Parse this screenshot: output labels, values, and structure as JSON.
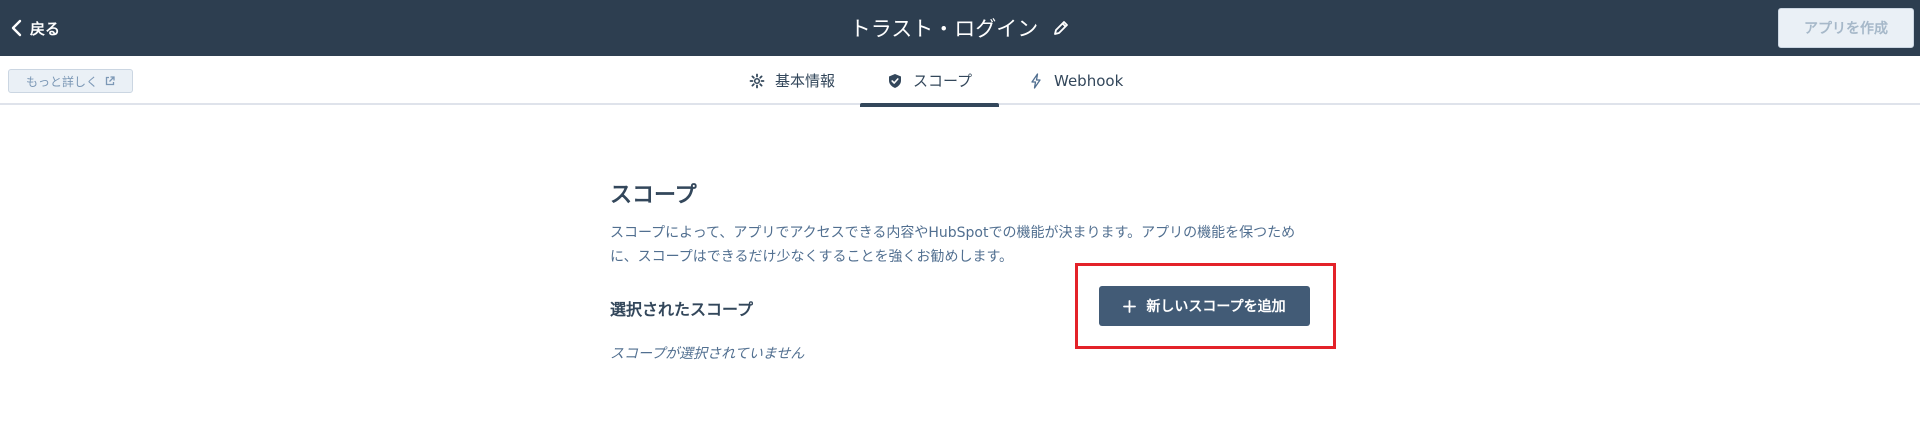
{
  "header": {
    "back_label": "戻る",
    "app_title": "トラスト・ログイン",
    "create_app_label": "アプリを作成"
  },
  "subheader": {
    "learn_more_label": "もっと詳しく",
    "tabs": [
      {
        "label": "基本情報",
        "icon": "gear-icon",
        "active": false
      },
      {
        "label": "スコープ",
        "icon": "shield-check-icon",
        "active": true
      },
      {
        "label": "Webhook",
        "icon": "lightning-icon",
        "active": false
      }
    ]
  },
  "main": {
    "title": "スコープ",
    "description_line1": "スコープによって、アプリでアクセスできる内容やHubSpotでの機能が決まります。アプリの機能を保つため",
    "description_line2": "に、スコープはできるだけ少なくすることを強くお勧めします。",
    "selected_scopes_label": "選択されたスコープ",
    "add_scope_label": "新しいスコープを追加",
    "empty_message": "スコープが選択されていません"
  },
  "colors": {
    "header_bg": "#2d3e50",
    "primary_button": "#425b76",
    "highlight": "#e32229"
  }
}
